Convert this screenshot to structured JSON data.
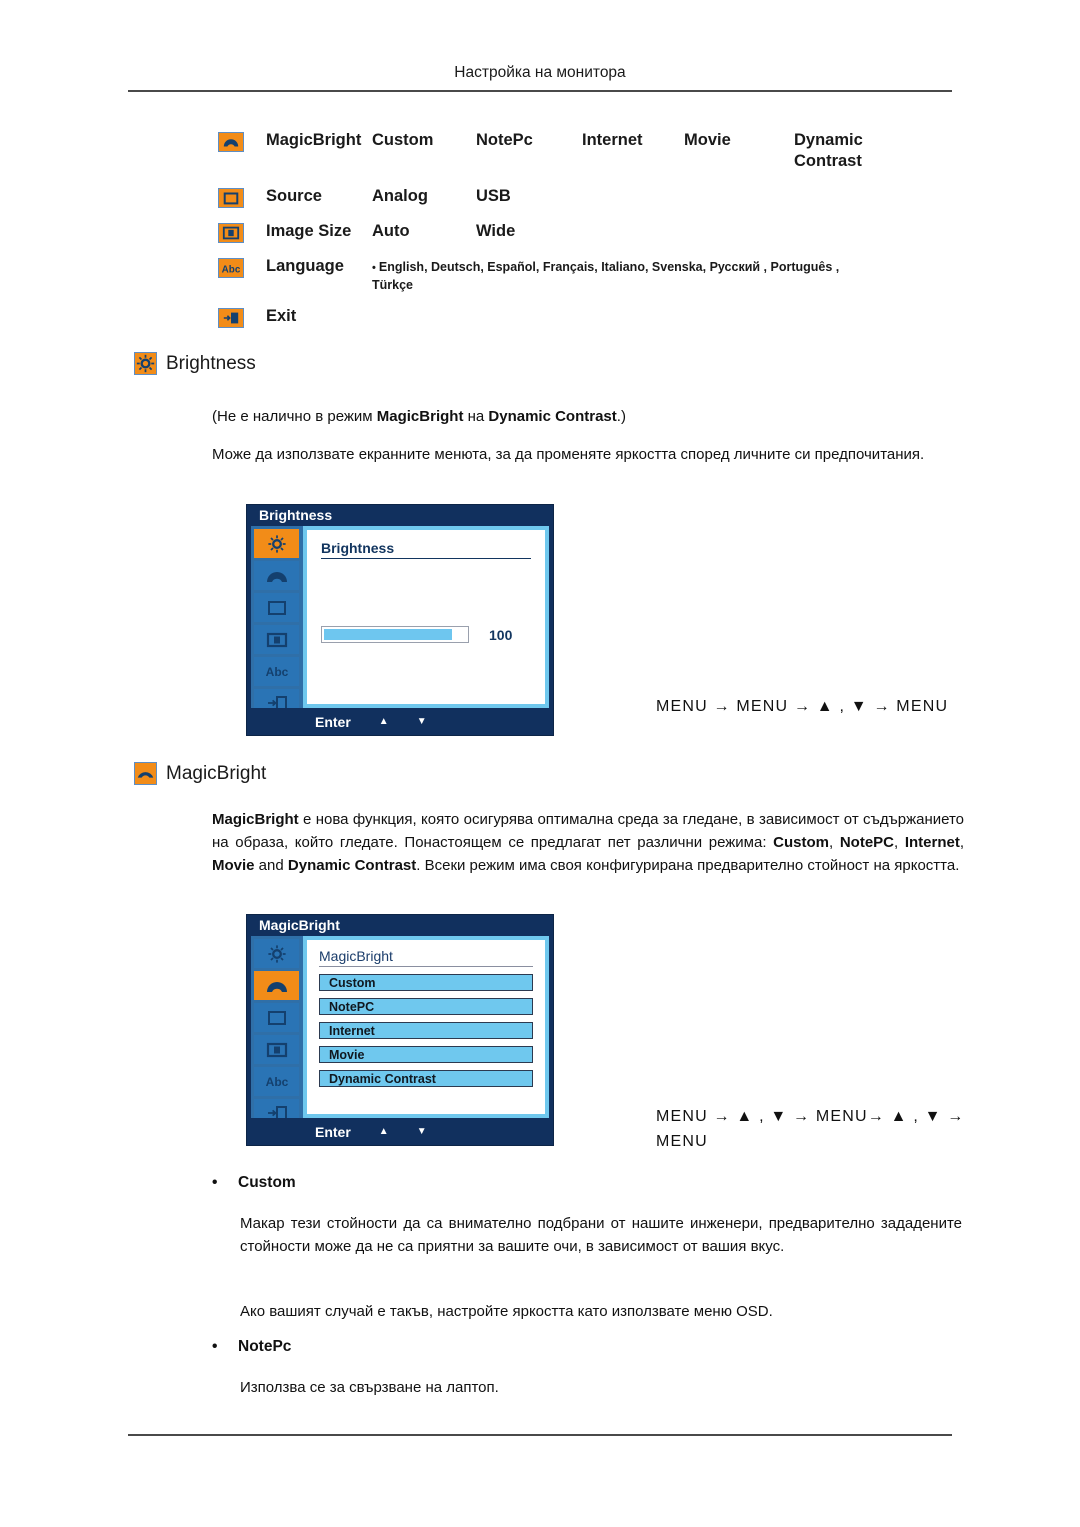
{
  "header": {
    "title": "Настройка на монитора"
  },
  "menu_matrix": {
    "rows": [
      {
        "icon": "magicbright-icon",
        "label": "MagicBright",
        "options": [
          "Custom",
          "NotePc",
          "Internet",
          "Movie",
          "Dynamic Contrast"
        ]
      },
      {
        "icon": "source-icon",
        "label": "Source",
        "options": [
          "Analog",
          "USB"
        ]
      },
      {
        "icon": "image-size-icon",
        "label": "Image Size",
        "options": [
          "Auto",
          "Wide"
        ]
      },
      {
        "icon": "language-icon",
        "label": "Language",
        "languages": "English, Deutsch, Español, Français,  Italiano, Svenska, Русский , Português , Türkçe"
      },
      {
        "icon": "exit-icon",
        "label": "Exit",
        "options": []
      }
    ]
  },
  "brightness_section": {
    "icon": "brightness-icon",
    "heading": "Brightness",
    "note": "(Не е налично в режим MagicBright на Dynamic Contrast.)",
    "note_parts": {
      "pre": "(Не е налично в режим ",
      "bold1": "MagicBright",
      "mid": " на ",
      "bold2": "Dynamic Contrast",
      "post": ".)"
    },
    "paragraph": "Може да използвате екранните менюта, за да променяте яркостта според личните си предпочитания.",
    "osd": {
      "title": "Brightness",
      "heading": "Brightness",
      "slider_value": "100",
      "slider_percent": 90,
      "footer": {
        "enter": "Enter",
        "up": "▲",
        "down": "▼"
      },
      "sidebar_icons": [
        "brightness-icon",
        "magicbright-icon",
        "source-icon",
        "image-size-icon",
        "language-icon",
        "exit-icon"
      ],
      "active_index": 0
    },
    "nav_path": "MENU → MENU → ▲ , ▼ → MENU"
  },
  "magicbright_section": {
    "icon": "magicbright-icon",
    "heading": "MagicBright",
    "paragraph_parts": {
      "bold1": "MagicBright",
      "t1": " е нова функция, която осигурява оптимална среда за гледане, в зависимост от съдържанието на образа, който гледате. Понастоящем се предлагат пет различни режима: ",
      "bold2": "Custom",
      "t2": ", ",
      "bold3": "NotePC",
      "t3": ", ",
      "bold4": "Internet",
      "t4": ", ",
      "bold5": "Movie",
      "t5": " and ",
      "bold6": "Dynamic Contrast",
      "t6": ". Всеки режим има своя конфигурирана предварително стойност на яркостта."
    },
    "osd": {
      "title": "MagicBright",
      "heading": "MagicBright",
      "options": [
        "Custom",
        "NotePC",
        "Internet",
        "Movie",
        "Dynamic Contrast"
      ],
      "footer": {
        "enter": "Enter",
        "up": "▲",
        "down": "▼"
      },
      "sidebar_icons": [
        "brightness-icon",
        "magicbright-icon",
        "source-icon",
        "image-size-icon",
        "language-icon",
        "exit-icon"
      ],
      "active_index": 1
    },
    "nav_path": "MENU → ▲ , ▼ → MENU→ ▲ , ▼ → MENU",
    "items": [
      {
        "bullet": "•",
        "title": "Custom",
        "paragraphs": [
          "Макар тези стойности да са внимателно подбрани от нашите инженери, предварително зададените стойности може да не са приятни за вашите очи, в зависимост от вашия вкус.",
          "Ако вашият случай е такъв, настройте яркостта като използвате меню OSD."
        ]
      },
      {
        "bullet": "•",
        "title": "NotePc",
        "paragraphs": [
          "Използва се за свързване на лаптоп."
        ]
      }
    ]
  },
  "colors": {
    "accent_orange": "#f28c18",
    "osd_navy": "#11305e",
    "osd_side_blue": "#2f6fa8",
    "osd_light_blue": "#6fc8ee",
    "rule_gray": "#4a4a4a"
  }
}
